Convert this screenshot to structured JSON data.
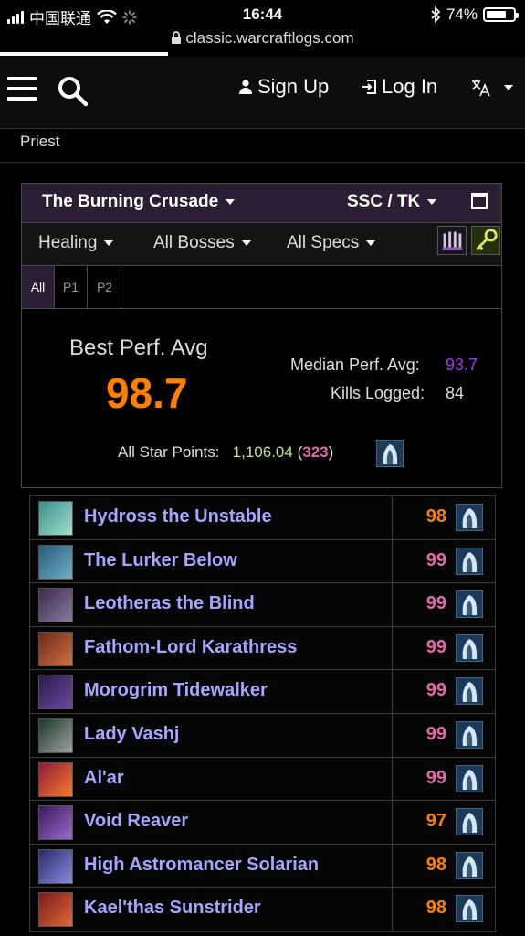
{
  "status_bar": {
    "carrier": "中国联通",
    "time": "16:44",
    "battery": "74%",
    "battery_level": 0.74,
    "url": "classic.warcraftlogs.com"
  },
  "nav": {
    "signup_label": "Sign Up",
    "login_label": "Log In",
    "icons": [
      "menu-icon",
      "search-icon",
      "person-icon",
      "login-icon",
      "translate-icon"
    ]
  },
  "breadcrumb": "Priest",
  "panel": {
    "expansion": "The Burning Crusade",
    "zone": "SSC / TK",
    "filters": {
      "metric": "Healing",
      "bosses": "All Bosses",
      "specs": "All Specs"
    },
    "tabs": [
      {
        "label": "All",
        "active": true
      },
      {
        "label": "P1",
        "active": false
      },
      {
        "label": "P2",
        "active": false
      }
    ],
    "best_perf_label": "Best Perf. Avg",
    "best_perf_value": "98.7",
    "median_label": "Median Perf. Avg:",
    "median_value": "93.7",
    "kills_label": "Kills Logged:",
    "kills_value": "84",
    "star_label": "All Star Points:",
    "star_points": "1,106.04",
    "star_paren_open": " (",
    "star_count": "323",
    "star_paren_close": ")"
  },
  "colors": {
    "accent_purple_bg": "#2b1d33",
    "legendary_orange": "#ff8000",
    "artifact_pink": "#e268a8",
    "epic_purple": "#a335ee",
    "boss_name": "#a6a6ff"
  },
  "bosses": [
    {
      "name": "Hydross the Unstable",
      "score": "98",
      "color": "#ff8000",
      "thumb": [
        "#3a8f8a",
        "#a0e0d0"
      ]
    },
    {
      "name": "The Lurker Below",
      "score": "99",
      "color": "#e268a8",
      "thumb": [
        "#2a5a7a",
        "#6fb0c8"
      ]
    },
    {
      "name": "Leotheras the Blind",
      "score": "99",
      "color": "#e268a8",
      "thumb": [
        "#3a2a4a",
        "#8a7aa0"
      ]
    },
    {
      "name": "Fathom-Lord Karathress",
      "score": "99",
      "color": "#e268a8",
      "thumb": [
        "#6a2a1a",
        "#d07040"
      ]
    },
    {
      "name": "Morogrim Tidewalker",
      "score": "99",
      "color": "#e268a8",
      "thumb": [
        "#2a1a4a",
        "#6a4aa0"
      ]
    },
    {
      "name": "Lady Vashj",
      "score": "99",
      "color": "#e268a8",
      "thumb": [
        "#1a3a2a",
        "#a0a0a0"
      ]
    },
    {
      "name": "Al'ar",
      "score": "99",
      "color": "#e268a8",
      "thumb": [
        "#8a1a3a",
        "#ff7a2a"
      ]
    },
    {
      "name": "Void Reaver",
      "score": "97",
      "color": "#ff8000",
      "thumb": [
        "#3a1a5a",
        "#9a6ad0"
      ]
    },
    {
      "name": "High Astromancer Solarian",
      "score": "98",
      "color": "#ff8000",
      "thumb": [
        "#2a2a6a",
        "#8a8ae0"
      ]
    },
    {
      "name": "Kael'thas Sunstrider",
      "score": "98",
      "color": "#ff8000",
      "thumb": [
        "#7a1a1a",
        "#e06a3a"
      ]
    }
  ]
}
